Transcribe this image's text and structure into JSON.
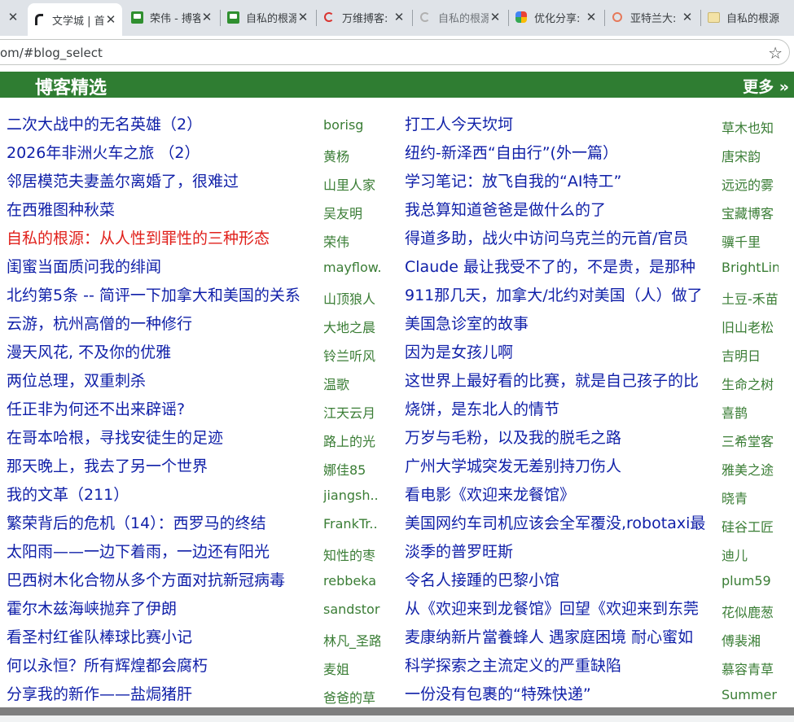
{
  "browser": {
    "tabs": [
      {
        "title": "",
        "icon": "partial-tab-icon",
        "active": false
      },
      {
        "title": "文学城 | 首",
        "icon": "wenxuecity-icon",
        "active": true
      },
      {
        "title": "荣伟 - 搏客",
        "icon": "blog-green-icon",
        "active": false
      },
      {
        "title": "自私的根源",
        "icon": "blog-green-icon",
        "active": false
      },
      {
        "title": "万维搏客:",
        "icon": "wanwei-icon",
        "active": false
      },
      {
        "title": "自私的根源",
        "icon": "wanwei-faded-icon",
        "active": false
      },
      {
        "title": "优化分享:",
        "icon": "multicolor-icon",
        "active": false
      },
      {
        "title": "亚特兰大:",
        "icon": "orange-circle-icon",
        "active": false
      },
      {
        "title": "自私的根源",
        "icon": "beige-icon",
        "active": false
      }
    ],
    "url": "om/#blog_select"
  },
  "panel": {
    "title": "博客精选",
    "more": "更多 »"
  },
  "rows": [
    {
      "t1": "二次大战中的无名英雄（2）",
      "a1": "borisg",
      "t2": "打工人今天坎坷",
      "a2": "草木也知"
    },
    {
      "t1": "2026年非洲火车之旅 （2）",
      "a1": "黄杨",
      "t2": "纽约-新泽西“自由行”(外一篇）",
      "a2": "唐宋韵"
    },
    {
      "t1": "邻居模范夫妻盖尔离婚了，很难过",
      "a1": "山里人家",
      "t2": "学习笔记：放飞自我的“AI特工”",
      "a2": "远远的雾"
    },
    {
      "t1": "在西雅图种秋菜",
      "a1": "吴友明",
      "t2": "我总算知道爸爸是做什么的了",
      "a2": "宝藏博客"
    },
    {
      "t1": "自私的根源：从人性到罪性的三种形态",
      "a1": "荣伟",
      "t2": "得道多助，战火中访问乌克兰的元首/官员",
      "a2": "骥千里"
    },
    {
      "t1": "闺蜜当面质问我的绯闻",
      "a1": "mayflow.",
      "t2": "Claude 最让我受不了的，不是贵，是那种",
      "a2": "BrightLin"
    },
    {
      "t1": "北约第5条 -- 简评一下加拿大和美国的关系",
      "a1": "山顶狼人",
      "t2": "911那几天，加拿大/北约对美国（人）做了",
      "a2": "土豆-禾苗"
    },
    {
      "t1": "云游，杭州高僧的一种修行",
      "a1": "大地之晨",
      "t2": "美国急诊室的故事",
      "a2": "旧山老松"
    },
    {
      "t1": "漫天风花, 不及你的优雅",
      "a1": "铃兰听风",
      "t2": "因为是女孩儿啊",
      "a2": "吉明日"
    },
    {
      "t1": "两位总理，双重刺杀",
      "a1": "温歌",
      "t2": "这世界上最好看的比赛，就是自己孩子的比",
      "a2": "生命之树"
    },
    {
      "t1": "任正非为何还不出来辟谣?",
      "a1": "江天云月",
      "t2": "烧饼，是东北人的情节",
      "a2": "喜鹊"
    },
    {
      "t1": "在哥本哈根，寻找安徒生的足迹",
      "a1": "路上的光",
      "t2": "万岁与毛粉，以及我的脱毛之路",
      "a2": "三希堂客"
    },
    {
      "t1": "那天晚上，我去了另一个世界",
      "a1": "娜佳85",
      "t2": "广州大学城突发无差别持刀伤人",
      "a2": "雅美之途"
    },
    {
      "t1": "我的文革（211）",
      "a1": "jiangsh..",
      "t2": "看电影《欢迎来龙餐馆》",
      "a2": "晓青"
    },
    {
      "t1": "繁荣背后的危机（14）：西罗马的终结",
      "a1": "FrankTr..",
      "t2": "美国网约车司机应该会全军覆没,robotaxi最",
      "a2": "硅谷工匠"
    },
    {
      "t1": "太阳雨——一边下着雨，一边还有阳光",
      "a1": "知性的枣",
      "t2": "淡季的普罗旺斯",
      "a2": "迪儿"
    },
    {
      "t1": "巴西树木化合物从多个方面对抗新冠病毒",
      "a1": "rebbeka",
      "t2": "令名人接踵的巴黎小馆",
      "a2": "plum59"
    },
    {
      "t1": "霍尔木兹海峡抛弃了伊朗",
      "a1": "sandstorm",
      "t2": "从《欢迎来到龙餐馆》回望《欢迎来到东莞",
      "a2": "花似鹿葱"
    },
    {
      "t1": "看圣村红雀队棒球比赛小记",
      "a1": "林凡_圣路",
      "t2": "麦康纳新片當養蜂人 遇家庭困境 耐心蜜如",
      "a2": "傅裴湘"
    },
    {
      "t1": "何以永恒？所有辉煌都会腐朽",
      "a1": "麦姐",
      "t2": "科学探索之主流定义的严重缺陷",
      "a2": "慕容青草"
    },
    {
      "t1": "分享我的新作——盐焗猪肝",
      "a1": "爸爸的草",
      "t2": "一份没有包裹的“特殊快递”",
      "a2": "Summer"
    }
  ],
  "highlight_color": "#e0201b",
  "title_color": "#0f1fa8",
  "author_color": "#3a7d35",
  "header_color": "#2f7d32"
}
